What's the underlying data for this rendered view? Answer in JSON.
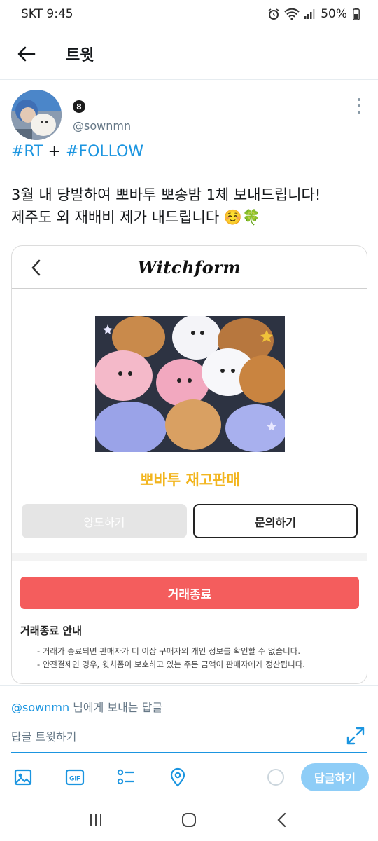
{
  "status_bar": {
    "carrier_time": "SKT 9:45",
    "battery": "50%"
  },
  "header": {
    "title": "트윗"
  },
  "tweet": {
    "badge": "8",
    "handle": "@sownmn",
    "hashtag_1": "#RT",
    "plus": " + ",
    "hashtag_2": "#FOLLOW",
    "line_1": "3월 내 당발하여 뽀바투 뽀송밤 1체 보내드립니다!",
    "line_2": "제주도 외 재배비 제가 내드립니다 ☺️🍀"
  },
  "card": {
    "brand": "Witchform",
    "product_title": "뽀바투 재고판매",
    "transfer_button": "양도하기",
    "inquiry_button": "문의하기",
    "closed_button": "거래종료",
    "notice_title": "거래종료 안내",
    "notices": [
      "거래가 종료되면 판매자가 더 이상 구매자의 개인 정보를 확인할 수 없습니다.",
      "안전결제인 경우, 윗치폼이 보호하고 있는 주문 금액이 판매자에게 정산됩니다."
    ]
  },
  "reply": {
    "mention": "@sownmn",
    "suffix": " 님에게 보내는 답글",
    "placeholder": "답글 트윗하기",
    "submit": "답글하기"
  },
  "colors": {
    "accent": "#1b95e0",
    "reply_button": "#8ecdf7",
    "closed_red": "#f45d5d",
    "product_title": "#f2b51e"
  }
}
